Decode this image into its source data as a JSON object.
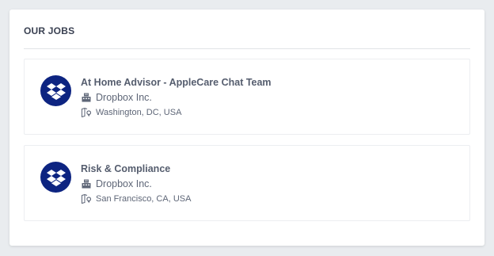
{
  "section": {
    "title": "OUR JOBS"
  },
  "jobs": [
    {
      "title": "At Home Advisor - AppleCare Chat Team",
      "company": "Dropbox Inc.",
      "location": "Washington, DC, USA",
      "logo_icon": "dropbox-logo",
      "company_icon": "building-icon",
      "location_icon": "map-pin-icon"
    },
    {
      "title": "Risk & Compliance",
      "company": "Dropbox Inc.",
      "location": "San Francisco, CA, USA",
      "logo_icon": "dropbox-logo",
      "company_icon": "building-icon",
      "location_icon": "map-pin-icon"
    }
  ],
  "colors": {
    "logo_bg": "#0d2481",
    "title_text": "#555d6e",
    "meta_text": "#5e6677",
    "background": "#e9ecef"
  }
}
